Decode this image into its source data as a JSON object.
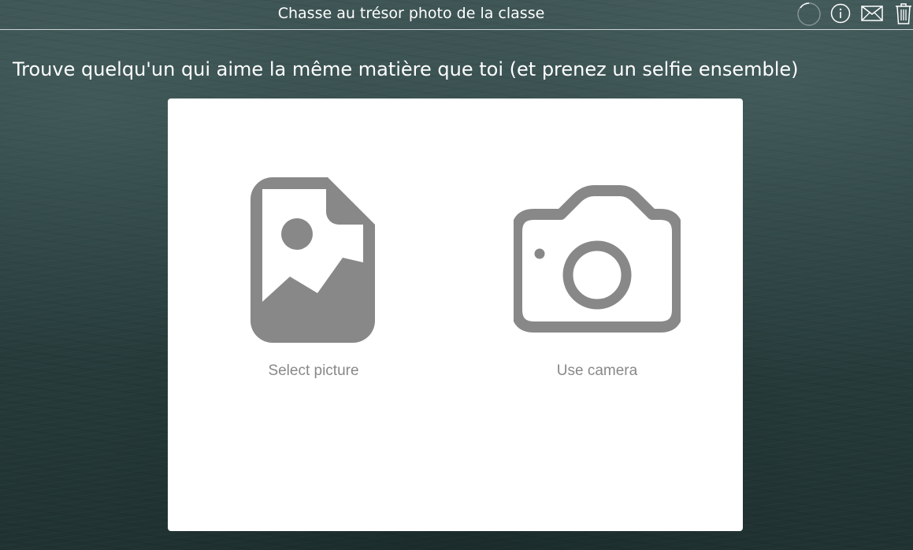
{
  "header": {
    "title": "Chasse au trésor photo de la classe",
    "icons": [
      "loading-spinner-icon",
      "info-icon",
      "mail-icon",
      "trash-icon"
    ]
  },
  "prompt": {
    "text": "Trouve quelqu'un qui aime la même matière que toi (et prenez un selfie ensemble)"
  },
  "upload": {
    "select_picture_label": "Select picture",
    "use_camera_label": "Use camera"
  },
  "colors": {
    "icon_gray": "#888888",
    "card_bg": "#ffffff",
    "header_text": "#ffffff"
  }
}
